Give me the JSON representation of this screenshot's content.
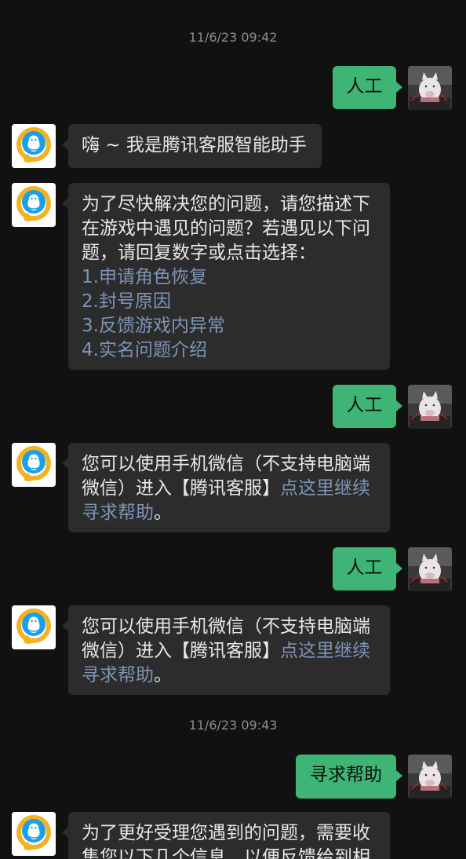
{
  "chat": {
    "timestamps": [
      "11/6/23 09:42",
      "11/6/23 09:43"
    ],
    "msg_out_1": "人工",
    "msg_in_1": "嗨 ~ 我是腾讯客服智能助手",
    "msg_in_2": {
      "lines": [
        "为了尽快解决您的问题，请您描述下",
        "在游戏中遇见的问题？若遇见以下问",
        "题，请回复数字或点击选择："
      ],
      "options": [
        "1.申请角色恢复",
        "2.封号原因",
        "3.反馈游戏内异常",
        "4.实名问题介绍"
      ]
    },
    "msg_out_2": "人工",
    "msg_in_3": {
      "line1": "您可以使用手机微信（不支持电脑端",
      "line2_text": "微信）进入【腾讯客服】",
      "line2_link": "点这里继续",
      "line3_link": "寻求帮助",
      "line3_text": "。"
    },
    "msg_out_3": "人工",
    "msg_in_4": {
      "line1": "您可以使用手机微信（不支持电脑端",
      "line2_text": "微信）进入【腾讯客服】",
      "line2_link": "点这里继续",
      "line3_link": "寻求帮助",
      "line3_text": "。"
    },
    "msg_out_4": "寻求帮助",
    "msg_in_5": {
      "line1": "为了更好受理您遇到的问题，需要收",
      "line2": "集您以下几个信息，以便反馈给到相"
    }
  },
  "colors": {
    "background": "#111111",
    "incoming_bubble": "#2c2c2c",
    "outgoing_bubble": "#3eb574",
    "link": "#7d94b5",
    "timestamp": "#8f8f8f"
  },
  "icons": {
    "bot_avatar": "qq-penguin-logo-icon",
    "user_avatar": "pig-photo-avatar"
  }
}
